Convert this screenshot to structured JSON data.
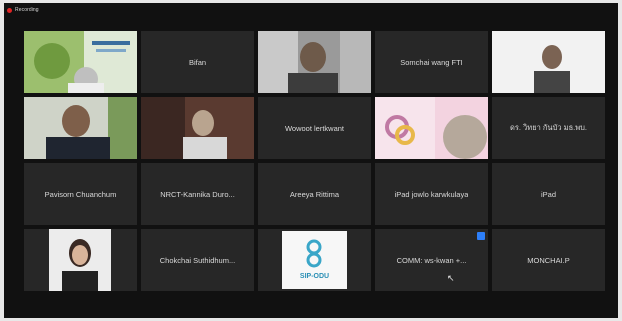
{
  "recording": {
    "label": "Recording",
    "color": "#e02424"
  },
  "participants": [
    {
      "name": "",
      "type": "video",
      "scene": "presentation"
    },
    {
      "name": "Bifan",
      "type": "name"
    },
    {
      "name": "",
      "type": "video",
      "scene": "man-room"
    },
    {
      "name": "Somchai wang FTI",
      "type": "name"
    },
    {
      "name": "",
      "type": "video",
      "scene": "man-white"
    },
    {
      "name": "",
      "type": "video",
      "scene": "man-suit",
      "active": true
    },
    {
      "name": "",
      "type": "video",
      "scene": "man-shelf"
    },
    {
      "name": "Wowoot lertkwant",
      "type": "name"
    },
    {
      "name": "",
      "type": "video",
      "scene": "logo-poster"
    },
    {
      "name": "ดร. วิทยา กันบัว มธ.พบ.",
      "type": "name"
    },
    {
      "name": "Pavisorn Chuanchum",
      "type": "name"
    },
    {
      "name": "NRCT-Kannika Duro...",
      "type": "name"
    },
    {
      "name": "Areeya Rittima",
      "type": "name"
    },
    {
      "name": "iPad jowlo karwkulaya",
      "type": "name"
    },
    {
      "name": "iPad",
      "type": "name"
    },
    {
      "name": "",
      "type": "video",
      "scene": "woman-portrait"
    },
    {
      "name": "Chokchai Suthidhum...",
      "type": "name"
    },
    {
      "name": "",
      "type": "video",
      "scene": "sip-logo",
      "logo_text": "SIP-ODU"
    },
    {
      "name": "COMM: ws-kwan +...",
      "type": "name",
      "badge": true,
      "cursor": true
    },
    {
      "name": "MONCHAI.P",
      "type": "name"
    }
  ],
  "colors": {
    "active_border": "#3fa83f",
    "tile_bg": "#272727",
    "badge": "#2d7ff9"
  },
  "icons": {
    "cursor": "mouse-pointer-icon",
    "badge": "screen-share-icon"
  }
}
